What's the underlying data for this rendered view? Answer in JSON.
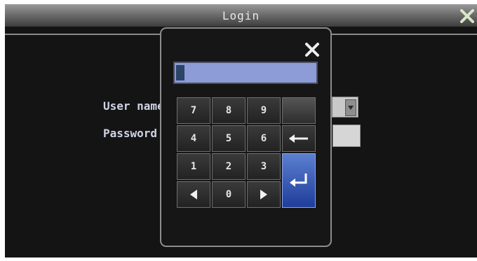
{
  "window": {
    "title": "Login"
  },
  "form": {
    "user_label": "User name",
    "password_label": "Password"
  },
  "keypad": {
    "input_value": "",
    "keys": [
      "7",
      "8",
      "9",
      "4",
      "5",
      "6",
      "1",
      "2",
      "3",
      "0"
    ]
  },
  "colors": {
    "title_gradient_top": "#9a9a9a",
    "background": "#141414",
    "entry_field": "#8d9bd6",
    "enter_key": "#2b4fb8"
  }
}
